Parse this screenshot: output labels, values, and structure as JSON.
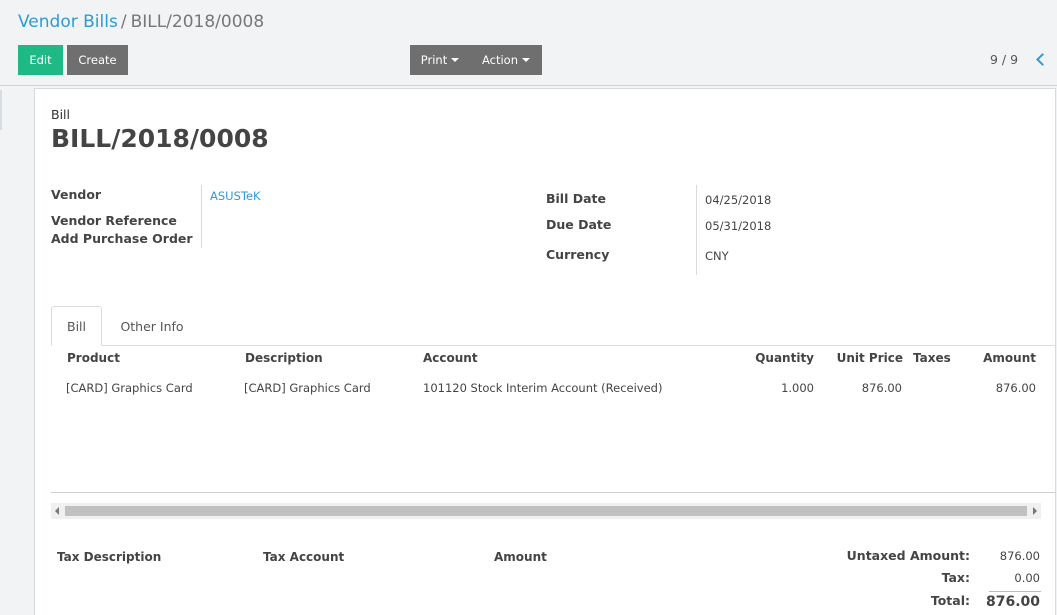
{
  "breadcrumb": {
    "parent": "Vendor Bills",
    "separator": "/",
    "current": "BILL/2018/0008"
  },
  "toolbar": {
    "edit_label": "Edit",
    "create_label": "Create",
    "print_label": "Print",
    "action_label": "Action"
  },
  "pager": {
    "value": "9 / 9"
  },
  "sheet": {
    "label": "Bill",
    "title": "BILL/2018/0008",
    "left_fields": {
      "vendor_label": "Vendor",
      "vendor_value": "ASUSTeK",
      "vendor_reference_label": "Vendor Reference",
      "add_po_label": "Add Purchase Order"
    },
    "right_fields": {
      "bill_date_label": "Bill Date",
      "bill_date_value": "04/25/2018",
      "due_date_label": "Due Date",
      "due_date_value": "05/31/2018",
      "currency_label": "Currency",
      "currency_value": "CNY"
    }
  },
  "tabs": [
    {
      "label": "Bill"
    },
    {
      "label": "Other Info"
    }
  ],
  "lines": {
    "headers": {
      "product": "Product",
      "description": "Description",
      "account": "Account",
      "quantity": "Quantity",
      "unit_price": "Unit Price",
      "taxes": "Taxes",
      "amount": "Amount"
    },
    "rows": [
      {
        "product": "[CARD] Graphics Card",
        "description": "[CARD] Graphics Card",
        "account": "101120 Stock Interim Account (Received)",
        "quantity": "1.000",
        "unit_price": "876.00",
        "taxes": "",
        "amount": "876.00"
      }
    ]
  },
  "tax_table": {
    "description": "Tax Description",
    "account": "Tax Account",
    "amount": "Amount"
  },
  "totals": {
    "untaxed_label": "Untaxed Amount:",
    "untaxed_value": "876.00",
    "tax_label": "Tax:",
    "tax_value": "0.00",
    "total_label": "Total:",
    "total_value": "876.00"
  }
}
